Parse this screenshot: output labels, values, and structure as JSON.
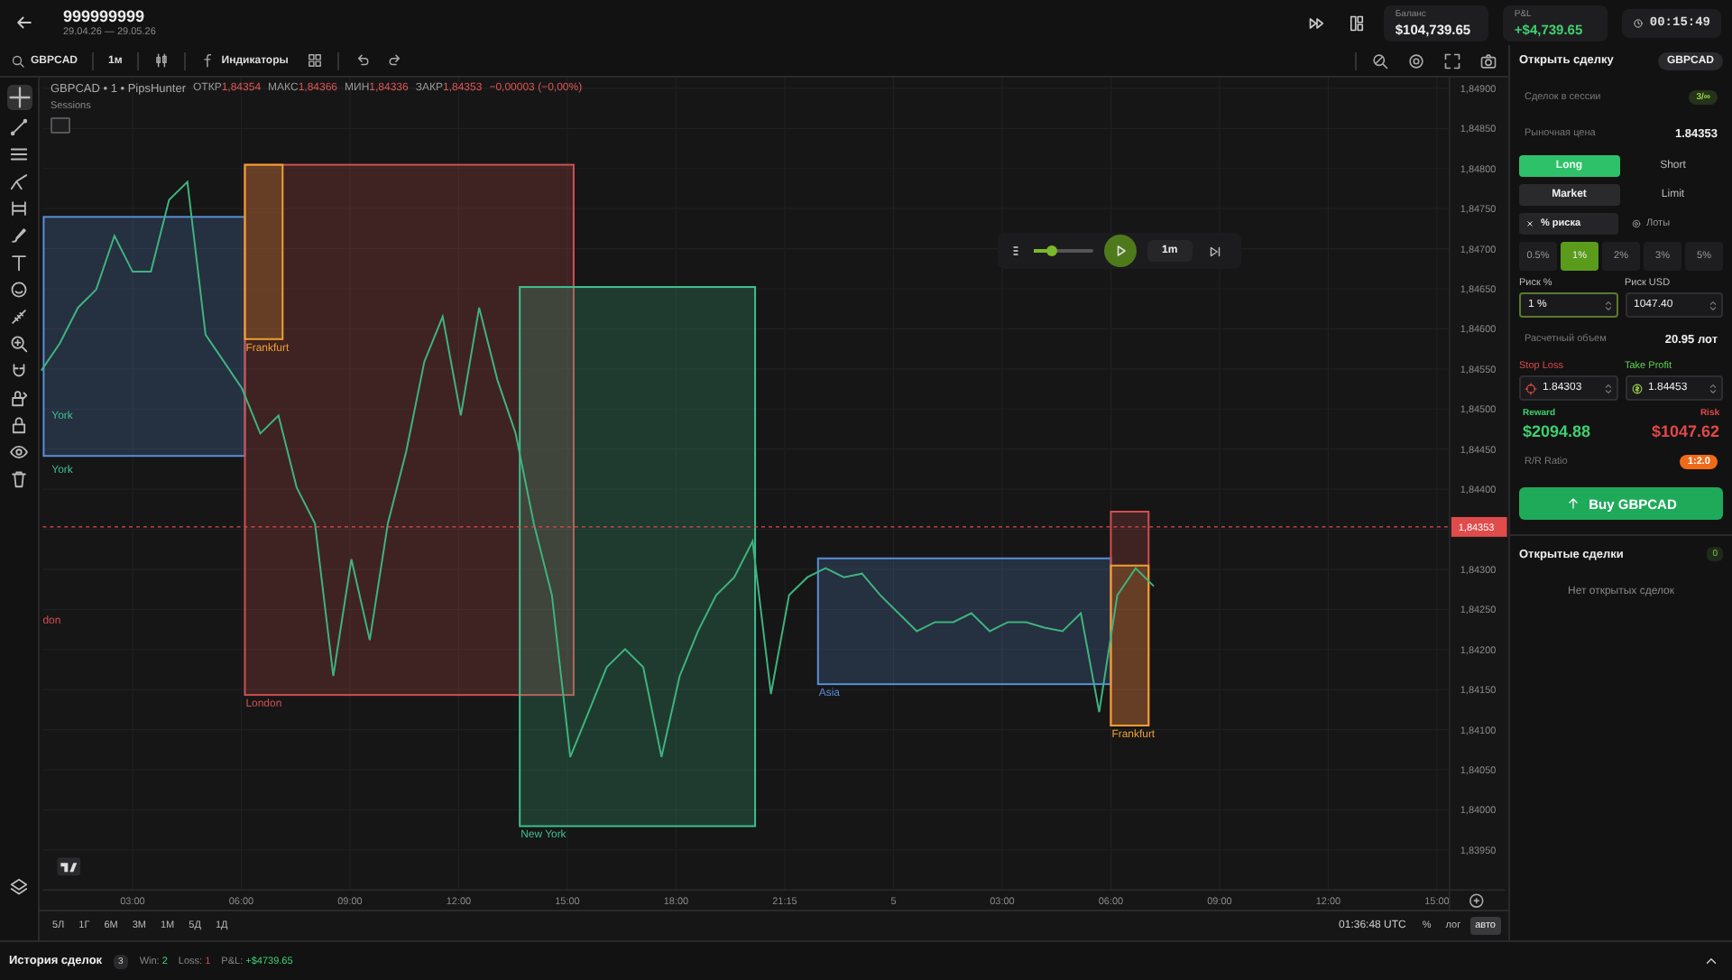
{
  "header": {
    "title": "999999999",
    "dates": "29.04.26 — 29.05.26",
    "balance": {
      "label": "Баланс",
      "value": "$104,739.65"
    },
    "pnl": {
      "label": "P&L",
      "value": "+$4,739.65"
    },
    "timer": "00:15:49"
  },
  "toolbar": {
    "symbol": "GBPCAD",
    "interval": "1м",
    "indicators": "Индикаторы"
  },
  "chart": {
    "legend": {
      "title": "GBPCAD • 1 • PipsHunter",
      "stats": [
        {
          "label": "ОТКР",
          "value": "1,84354"
        },
        {
          "label": "МАКС",
          "value": "1,84366"
        },
        {
          "label": "МИН",
          "value": "1,84336"
        },
        {
          "label": "ЗАКР",
          "value": "1,84353"
        }
      ],
      "change": "−0,00003 (−0,00%)"
    },
    "studies_label": "Sessions",
    "replay": {
      "level": 0.3,
      "speed": "1m"
    },
    "sessions": [
      {
        "kind": "box",
        "color": "#5b8fd6"
      },
      {
        "kind": "box",
        "label": "London",
        "color": "#d05050"
      },
      {
        "kind": "box",
        "label": "Frankfurt",
        "color": "#f0a030"
      },
      {
        "kind": "box",
        "label": "New York",
        "color": "#3fbf8f"
      },
      {
        "kind": "box",
        "label": "Asia",
        "color": "#5b8fd6"
      },
      {
        "kind": "box",
        "color": "#d05050"
      },
      {
        "kind": "box",
        "label": "Frankfurt",
        "color": "#f0a030"
      },
      {
        "kind": "label",
        "label": "York",
        "color": "#3fbf8f"
      },
      {
        "kind": "label",
        "label": "York",
        "color": "#3fbf8f"
      },
      {
        "kind": "label",
        "label": "don",
        "color": "#d05050"
      }
    ],
    "price_axis": [
      "1,84900",
      "1,84850",
      "1,84800",
      "1,84750",
      "1,84700",
      "1,84650",
      "1,84600",
      "1,84550",
      "1,84500",
      "1,84450",
      "1,84400",
      "1,84300",
      "1,84250",
      "1,84200",
      "1,84150",
      "1,84100",
      "1,84050",
      "1,84000",
      "1,83950"
    ],
    "last_price": "1,84353",
    "time_axis": [
      "03:00",
      "06:00",
      "09:00",
      "12:00",
      "15:00",
      "18:00",
      "21:15",
      "5",
      "03:00",
      "06:00",
      "09:00",
      "12:00",
      "15:00"
    ],
    "ranges": [
      {
        "label": "5Л",
        "selected": false
      },
      {
        "label": "1Г",
        "selected": false
      },
      {
        "label": "6М",
        "selected": false
      },
      {
        "label": "3М",
        "selected": false
      },
      {
        "label": "1М",
        "selected": false
      },
      {
        "label": "5Д",
        "selected": false
      },
      {
        "label": "1Д",
        "selected": false
      }
    ],
    "clock": "01:36:48 UTC",
    "scale": [
      {
        "label": "%",
        "selected": false
      },
      {
        "label": "лог",
        "selected": false
      },
      {
        "label": "авто",
        "selected": true
      }
    ]
  },
  "order_panel": {
    "title": "Открыть сделку",
    "symbol": "GBPCAD",
    "session_trades": {
      "label": "Сделок в сессии",
      "value": "3/∞"
    },
    "market_price": {
      "label": "Рыночная цена",
      "value": "1.84353"
    },
    "direction": [
      {
        "label": "Long",
        "selected": true
      },
      {
        "label": "Short",
        "selected": false
      }
    ],
    "order_type": [
      {
        "label": "Market",
        "selected": true
      },
      {
        "label": "Limit",
        "selected": false
      }
    ],
    "size_mode": [
      {
        "label": "% риска",
        "selected": true
      },
      {
        "label": "Лоты",
        "selected": false
      }
    ],
    "risk_presets": [
      {
        "label": "0.5%",
        "selected": false
      },
      {
        "label": "1%",
        "selected": true
      },
      {
        "label": "2%",
        "selected": false
      },
      {
        "label": "3%",
        "selected": false
      },
      {
        "label": "5%",
        "selected": false
      }
    ],
    "risk_percent": {
      "label": "Риск %",
      "value": "1 %"
    },
    "risk_usd": {
      "label": "Риск USD",
      "value": "1047.40"
    },
    "volume": {
      "label": "Расчетный объем",
      "value": "20.95 лот"
    },
    "stop_loss": {
      "label": "Stop Loss",
      "value": "1.84303"
    },
    "take_profit": {
      "label": "Take Profit",
      "value": "1.84453"
    },
    "reward": {
      "label": "Reward",
      "value": "$2094.88"
    },
    "risk": {
      "label": "Risk",
      "value": "$1047.62"
    },
    "rr": {
      "label": "R/R Ratio",
      "value": "1:2.0"
    },
    "submit": "Buy GBPCAD",
    "open_trades": {
      "title": "Открытые сделки",
      "count": "0",
      "empty": "Нет открытых сделок"
    }
  },
  "history": {
    "title": "История сделок",
    "count": "3",
    "stats": [
      {
        "kind": "win",
        "label": "Win:",
        "value": "2"
      },
      {
        "kind": "loss",
        "label": "Loss:",
        "value": "1"
      },
      {
        "kind": "pnl",
        "label": "P&L:",
        "value": "+$4739.65"
      }
    ]
  }
}
